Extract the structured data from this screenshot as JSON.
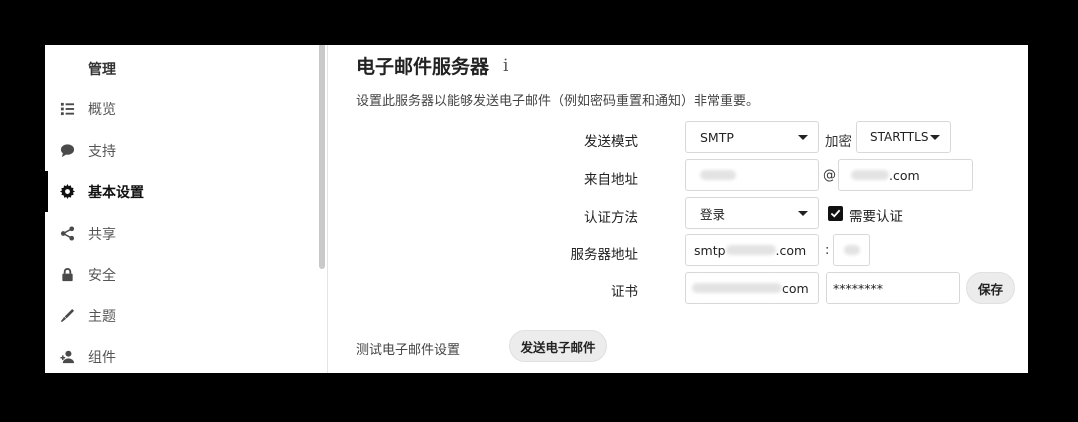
{
  "sidebar": {
    "heading": "管理",
    "items": [
      {
        "label": "概览",
        "icon": "list-icon"
      },
      {
        "label": "支持",
        "icon": "chat-bubble-icon"
      },
      {
        "label": "基本设置",
        "icon": "gear-icon",
        "active": true
      },
      {
        "label": "共享",
        "icon": "share-icon"
      },
      {
        "label": "安全",
        "icon": "lock-icon"
      },
      {
        "label": "主题",
        "icon": "paint-brush-icon"
      },
      {
        "label": "组件",
        "icon": "user-add-icon"
      }
    ]
  },
  "email_server": {
    "title": "电子邮件服务器",
    "info_icon": "i",
    "description": "设置此服务器以能够发送电子邮件（例如密码重置和通知）非常重要。",
    "send_mode": {
      "label": "发送模式",
      "value": "SMTP"
    },
    "encryption": {
      "label": "加密",
      "value": "STARTTLS"
    },
    "from_address": {
      "label": "来自地址",
      "at": "@",
      "domain_suffix": ".com"
    },
    "auth_method": {
      "label": "认证方法",
      "value": "登录"
    },
    "auth_required": {
      "label": "需要认证",
      "checked": true
    },
    "server_address": {
      "label": "服务器地址",
      "host_prefix": "smtp",
      "host_suffix": ".com",
      "port_sep": ":"
    },
    "credentials": {
      "label": "证书",
      "user_suffix": "com",
      "password": "********"
    },
    "save_button": "保存",
    "test": {
      "label": "测试电子邮件设置",
      "button": "发送电子邮件"
    }
  }
}
